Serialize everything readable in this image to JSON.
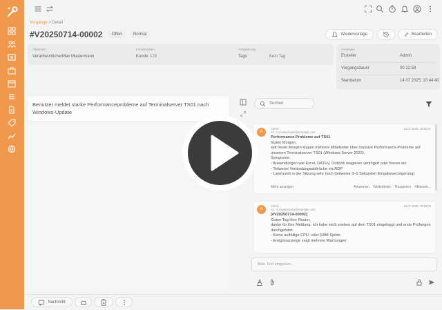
{
  "breadcrumb": {
    "link": "Vorgänge",
    "sep": ">",
    "current": "Detail"
  },
  "ticket": {
    "id": "#V20250714-00002",
    "status": "Offen",
    "priority": "Normal"
  },
  "header_buttons": {
    "wiedervorlage": "Wiedervorlage",
    "bearbeiten": "Bearbeiten"
  },
  "info": {
    "allgemein": {
      "label": "Allgemein",
      "value": "VerantwortlicherMax Mustermann"
    },
    "kundendaten": {
      "label": "Kundendaten",
      "kunde_label": "Kunde",
      "kunde_value": "123"
    },
    "gruppierung": {
      "label": "Gruppierung",
      "tags_label": "Tags",
      "tags_value": "Kein Tag"
    },
    "sonstiges": {
      "label": "Sonstiges",
      "rows": [
        {
          "key": "Ersteller",
          "value": "Admin"
        },
        {
          "key": "Vorgangsdauer",
          "value": "00:12:58"
        },
        {
          "key": "Startdatum",
          "value": "14.07.2025, 10:44:40"
        }
      ]
    }
  },
  "description": "Benutzer meldet starke Performanceprobleme auf Terminalserver TS01 nach Windows-Update",
  "search": {
    "placeholder": "Suchen"
  },
  "messages": [
    {
      "avatar": "A",
      "from": "Admin",
      "to": "An: m.mustermann@example.com",
      "date": "14.07.2025, 10:50:27",
      "subject": "Performance-Probleme auf TS01",
      "lines": [
        "Guten Morgen,",
        "seit heute Morgen klagen mehrere Mitarbeiter über massive Performance-Probleme auf unserem Terminalserver TS01 (Windows Server 2022).",
        "Symptome:",
        "- Anwendungen wie Excel, DATEV, Outlook reagieren verzögert oder frieren ein",
        "- Teilweise Verbindungsabbrüche via RDP",
        "- Latenzzeit in der Sitzung sehr hoch (teilweise 3–5 Sekunden Eingabeverzögerung)"
      ],
      "more": "Mehr anzeigen",
      "actions": [
        "Antworten",
        "Weiterleiten",
        "Reagieren",
        "Aktionen..."
      ]
    },
    {
      "avatar": "A",
      "from": "Admin",
      "to": "An: m.mustermann@example.com",
      "date": "14.07.2025, 10:53:04",
      "subject": "[#V20250714-00002]",
      "lines": [
        "Guten Tag Herr Reuter,",
        "danke für Ihre Meldung. Ich habe mich soeben auf dem TS01 eingeloggt und erste Prüfungen durchgeführt:",
        "- Keine auffällige CPU- oder RAM-Spitze",
        "- Ereignisanzeige zeigt mehrere Warnungen:"
      ]
    }
  ],
  "compose": {
    "placeholder": "Bitte Text eingeben..."
  },
  "bottom": {
    "nachricht": "Nachricht"
  },
  "colors": {
    "accent": "#ec7c1a",
    "play_dark": "#3b3b3b"
  },
  "icons": [
    "logo-icon",
    "dashboard-icon",
    "users-icon",
    "tickets-icon",
    "briefcase-icon",
    "calendar-icon",
    "list-icon",
    "document-icon",
    "tag-icon",
    "chart-icon",
    "globe-icon",
    "menu-icon",
    "swap-icon",
    "fullscreen-icon",
    "search-icon",
    "timer-icon",
    "bell-icon",
    "user-circle-icon",
    "more-vertical-icon",
    "play-icon"
  ]
}
